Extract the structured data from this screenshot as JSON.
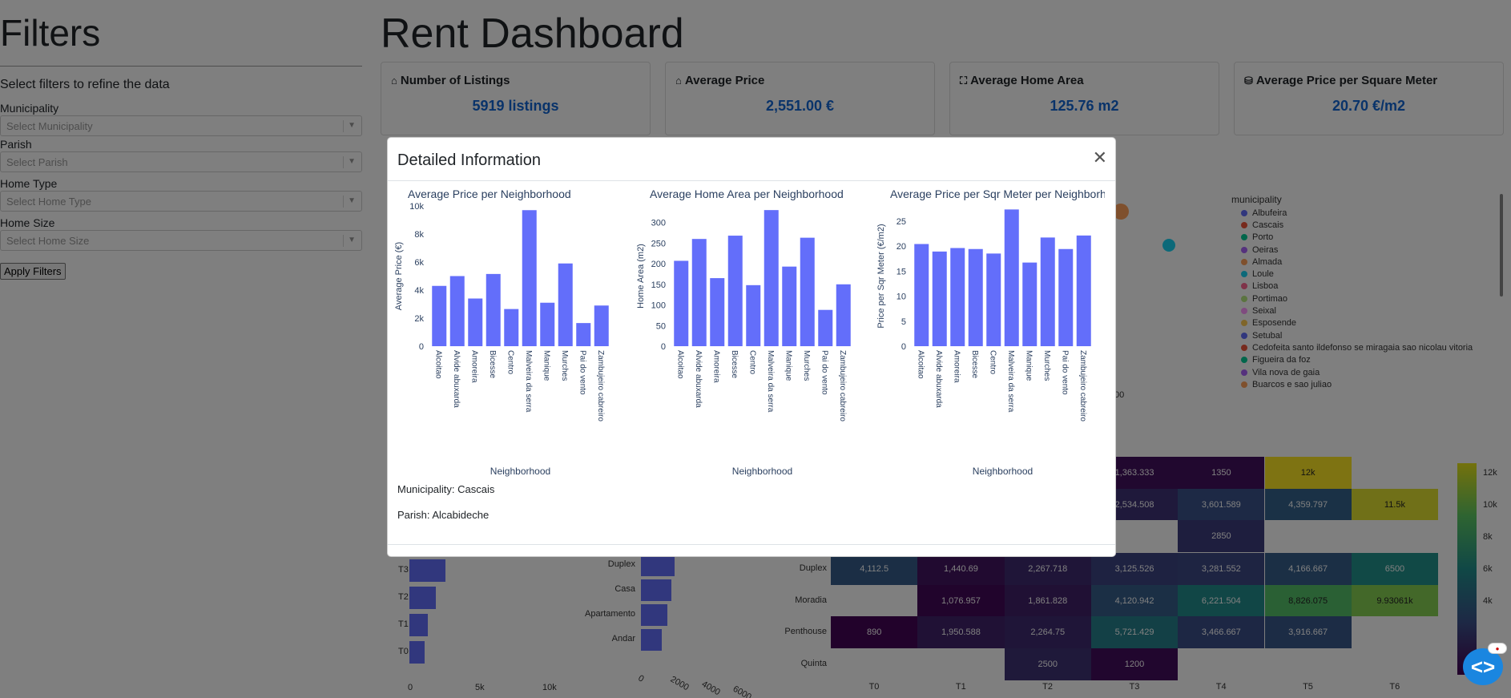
{
  "sidebar": {
    "title": "Filters",
    "subtitle": "Select filters to refine the data",
    "filters": [
      {
        "label": "Municipality",
        "placeholder": "Select Municipality"
      },
      {
        "label": "Parish",
        "placeholder": "Select Parish"
      },
      {
        "label": "Home Type",
        "placeholder": "Select Home Type"
      },
      {
        "label": "Home Size",
        "placeholder": "Select Home Size"
      }
    ],
    "apply_label": "Apply Filters"
  },
  "dashboard": {
    "title": "Rent Dashboard",
    "cards": [
      {
        "icon": "home-icon",
        "title": "Number of Listings",
        "value": "5919 listings"
      },
      {
        "icon": "home-icon",
        "title": "Average Price",
        "value": "2,551.00 €"
      },
      {
        "icon": "expand-icon",
        "title": "Average Home Area",
        "value": "125.76 m2"
      },
      {
        "icon": "coins-icon",
        "title": "Average Price per Square Meter",
        "value": "20.70 €/m2"
      }
    ],
    "legend": {
      "title": "municipality",
      "items": [
        {
          "name": "Albufeira",
          "color": "#636efa"
        },
        {
          "name": "Cascais",
          "color": "#ef553b"
        },
        {
          "name": "Porto",
          "color": "#00cc96"
        },
        {
          "name": "Oeiras",
          "color": "#ab63fa"
        },
        {
          "name": "Almada",
          "color": "#ffa15a"
        },
        {
          "name": "Loule",
          "color": "#19d3f3"
        },
        {
          "name": "Lisboa",
          "color": "#ff6692"
        },
        {
          "name": "Portimao",
          "color": "#b6e880"
        },
        {
          "name": "Seixal",
          "color": "#ff97ff"
        },
        {
          "name": "Esposende",
          "color": "#fecb52"
        },
        {
          "name": "Setubal",
          "color": "#636efa"
        },
        {
          "name": "Cedofeita santo ildefonso se miragaia sao nicolau vitoria",
          "color": "#ef553b"
        },
        {
          "name": "Figueira da foz",
          "color": "#00cc96"
        },
        {
          "name": "Vila nova de gaia",
          "color": "#ab63fa"
        },
        {
          "name": "Buarcos e sao juliao",
          "color": "#ffa15a"
        }
      ]
    },
    "bubble_axis_fragment": "00",
    "heatmap": {
      "columns": [
        "T0",
        "T1",
        "T2",
        "T3",
        "T4",
        "T5",
        "T6"
      ],
      "rows": [
        "Duplex",
        "Moradia",
        "Penthouse",
        "Quinta"
      ],
      "top_rows": [
        [
          null,
          null,
          null,
          "1,363.333",
          "1350",
          "12k",
          null
        ],
        [
          null,
          null,
          null,
          "2,534.508",
          "3,601.589",
          "4,359.797",
          "11.5k"
        ],
        [
          null,
          null,
          null,
          null,
          "2850",
          null,
          null
        ]
      ],
      "cells": [
        [
          "4,112.5",
          "1,440.69",
          "2,267.718",
          "3,125.526",
          "3,281.552",
          "4,166.667",
          "6500"
        ],
        [
          null,
          "1,076.957",
          "1,861.828",
          "4,120.942",
          "6,221.504",
          "8,826.075",
          "9.93061k"
        ],
        [
          "890",
          "1,950.588",
          "2,264.75",
          "5,721.429",
          "3,466.667",
          "3,916.667",
          null
        ],
        [
          null,
          null,
          "2500",
          "1200",
          null,
          null,
          null
        ]
      ],
      "colorbar_ticks": [
        "12k",
        "10k",
        "8k",
        "6k",
        "4k"
      ]
    },
    "size_bars": {
      "labels": [
        "T3",
        "T2",
        "T1",
        "T0"
      ],
      "x_ticks": [
        "0",
        "5k",
        "10k"
      ]
    },
    "type_bars": {
      "labels": [
        "Duplex",
        "Casa",
        "Apartamento",
        "Andar"
      ],
      "x_ticks": [
        "0",
        "2000",
        "4000",
        "6000"
      ]
    }
  },
  "modal": {
    "title": "Detailed Information",
    "municipality_line": "Municipality: Cascais",
    "parish_line": "Parish: Alcabideche"
  },
  "chart_data": [
    {
      "type": "bar",
      "title": "Average Price per Neighborhood",
      "xlabel": "Neighborhood",
      "ylabel": "Average Price (€)",
      "ylim": [
        0,
        10000
      ],
      "y_ticks": [
        "0",
        "2k",
        "4k",
        "6k",
        "8k",
        "10k"
      ],
      "categories": [
        "Alcoitao",
        "Alvide abuxarda",
        "Amoreira",
        "Bicesse",
        "Centro",
        "Malveira da serra",
        "Manique",
        "Murches",
        "Pai do vento",
        "Zambujeiro cabreiro"
      ],
      "values": [
        4300,
        5000,
        3400,
        5150,
        2650,
        9700,
        3100,
        5900,
        1650,
        2900
      ],
      "color": "#636efa"
    },
    {
      "type": "bar",
      "title": "Average Home Area per Neighborhood",
      "xlabel": "Neighborhood",
      "ylabel": "Home Area (m2)",
      "ylim": [
        0,
        340
      ],
      "y_ticks": [
        "0",
        "50",
        "100",
        "150",
        "200",
        "250",
        "300"
      ],
      "categories": [
        "Alcoitao",
        "Alvide abuxarda",
        "Amoreira",
        "Bicesse",
        "Centro",
        "Malveira da serra",
        "Manique",
        "Murches",
        "Pai do vento",
        "Zambujeiro cabreiro"
      ],
      "values": [
        207,
        260,
        165,
        268,
        148,
        330,
        193,
        263,
        88,
        150
      ],
      "color": "#636efa"
    },
    {
      "type": "bar",
      "title": "Average Price per Sqr Meter per Neighborhood",
      "xlabel": "Neighborhood",
      "ylabel": "Price per Sqr Meter (€/m2)",
      "ylim": [
        0,
        28
      ],
      "y_ticks": [
        "0",
        "5",
        "10",
        "15",
        "20",
        "25"
      ],
      "categories": [
        "Alcoitao",
        "Alvide abuxarda",
        "Amoreira",
        "Bicesse",
        "Centro",
        "Malveira da serra",
        "Manique",
        "Murches",
        "Pai do vento",
        "Zambujeiro cabreiro"
      ],
      "values": [
        20.4,
        18.9,
        19.6,
        19.4,
        18.5,
        27.3,
        16.7,
        21.7,
        19.4,
        22.1
      ],
      "color": "#636efa"
    }
  ]
}
